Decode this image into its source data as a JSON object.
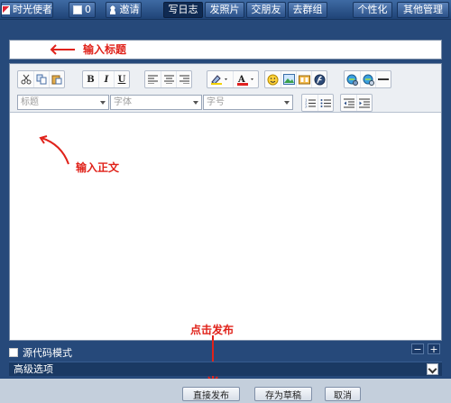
{
  "topbar": {
    "app_name": "时光使者",
    "mail_count": "0",
    "invite": "邀请",
    "tabs": [
      "写日志",
      "发照片",
      "交朋友",
      "去群组"
    ],
    "personalize": "个性化",
    "other_admin": "其他管理"
  },
  "annotations": {
    "title_hint": "输入标题",
    "body_hint": "输入正文",
    "publish_hint": "点击发布"
  },
  "toolbar": {
    "bold": "B",
    "italic": "I",
    "underline": "U",
    "heading_placeholder": "标题",
    "font_placeholder": "字体",
    "size_placeholder": "字号"
  },
  "bottom": {
    "source_mode": "源代码模式",
    "advanced": "高级选项",
    "zoom_out": "−",
    "zoom_in": "+"
  },
  "actions": {
    "publish": "直接发布",
    "save_draft": "存为草稿",
    "cancel": "取消"
  },
  "colors": {
    "background": "#26497a",
    "annotation": "#e0221a"
  }
}
